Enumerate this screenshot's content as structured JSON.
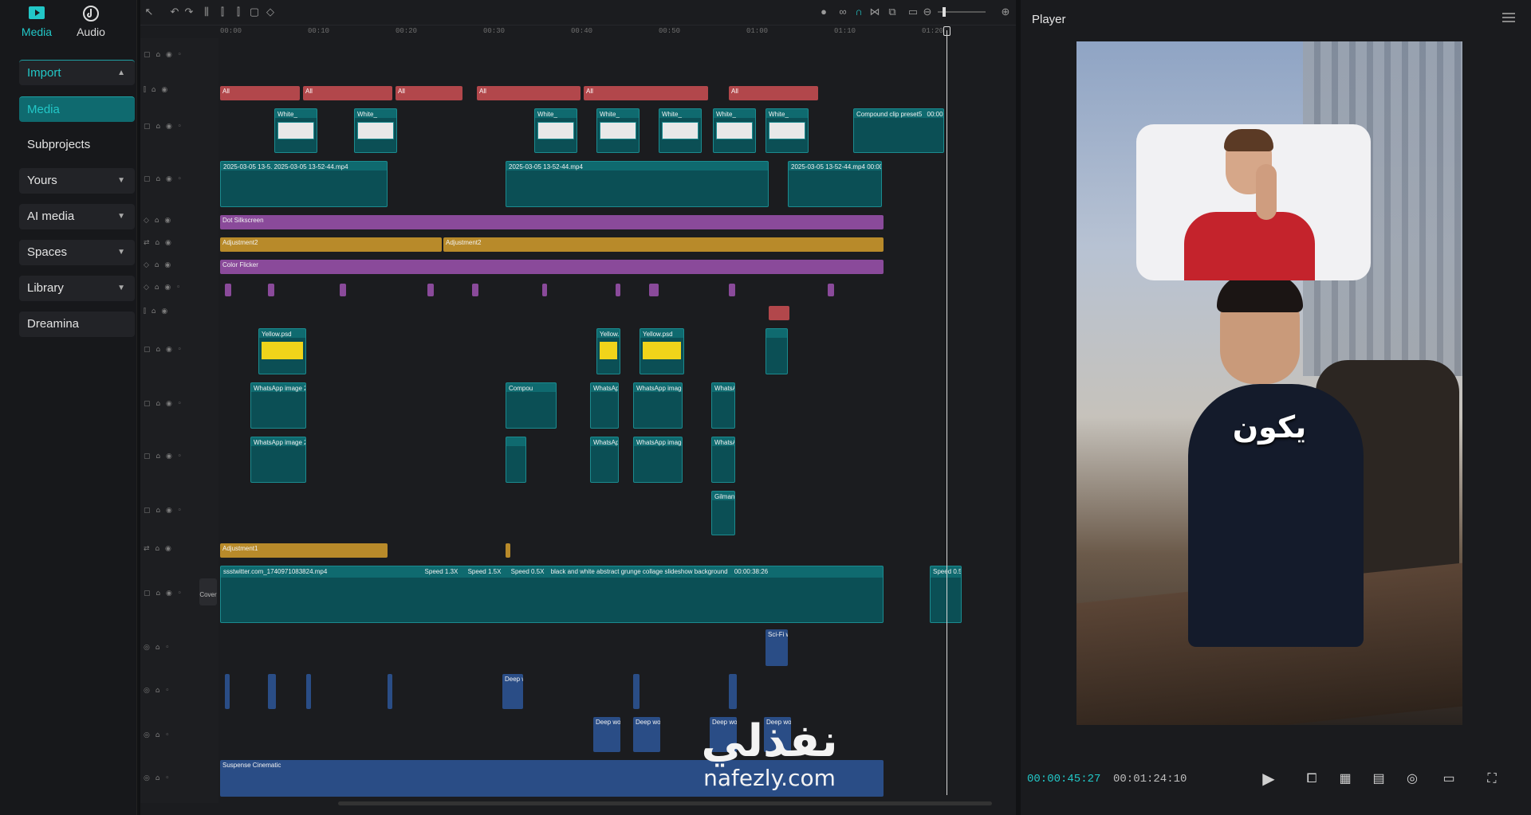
{
  "left_panel": {
    "tabs": [
      {
        "label": "Media",
        "icon": "media-icon",
        "active": true
      },
      {
        "label": "Audio",
        "icon": "audio-icon",
        "active": false
      }
    ],
    "nav": [
      {
        "label": "Import",
        "expandable": true,
        "expanded": true
      },
      {
        "label": "Media"
      },
      {
        "label": "Subprojects"
      },
      {
        "label": "Yours",
        "expandable": true
      },
      {
        "label": "AI media",
        "expandable": true
      },
      {
        "label": "Spaces",
        "expandable": true
      },
      {
        "label": "Library",
        "expandable": true
      },
      {
        "label": "Dreamina"
      }
    ]
  },
  "timeline": {
    "ruler_ticks": [
      "00:00",
      "00:10",
      "00:20",
      "00:30",
      "00:40",
      "00:50",
      "01:00",
      "01:10",
      "01:20"
    ],
    "clip_labels": {
      "compound": "Compound clip preset5",
      "compound_time": "00:00:10",
      "video_a": "2025-03-05 13-5.",
      "video_b": "2025-03-05 13-52-44.mp4",
      "video_end": "2025-03-05 13-52-44.mp4",
      "video_end_time": "00:00:10:27",
      "dot_silk": "Dot Silkscreen",
      "adjust2": "Adjustment2",
      "adjust3": "Adjustment2",
      "color_flicker": "Color Flicker",
      "yellow": "Yellow.psd",
      "yellow_time": "00:00:0",
      "whatsapp": "WhatsApp image 2025",
      "whatsapp_short": "WhatsAp",
      "compo": "Compou",
      "gilman": "Gilman-M",
      "adjust1": "Adjustment1",
      "main_video": "ssstwitter.com_1740971083824.mp4",
      "main_speed1": "Speed 1.3X",
      "main_speed2": "Speed 1.5X",
      "main_speed3": "Speed 0.5X",
      "main_bg": "black and white abstract grunge collage slideshow background",
      "main_bg_time": "00:00:38:26",
      "main_speed_end": "Speed 0.5",
      "cover": "Cover",
      "sfx1": "Sci-Fi woo",
      "sfx_deep": "Deep woos",
      "music": "Suspense Cinematic",
      "white": "White_",
      "red_label": "All"
    }
  },
  "player": {
    "title": "Player",
    "caption": "يكون",
    "timecode_current": "00:00:45:27",
    "timecode_total": "00:01:24:10"
  },
  "watermark": {
    "arabic": "نفذلي",
    "url": "nafezly.com"
  },
  "colors": {
    "accent": "#22c7c7",
    "clip_red": "#b2474b",
    "clip_teal": "#0f6a6f",
    "clip_purple": "#8a4a9a",
    "clip_gold": "#b88a2a",
    "clip_blue": "#2a4d86"
  }
}
